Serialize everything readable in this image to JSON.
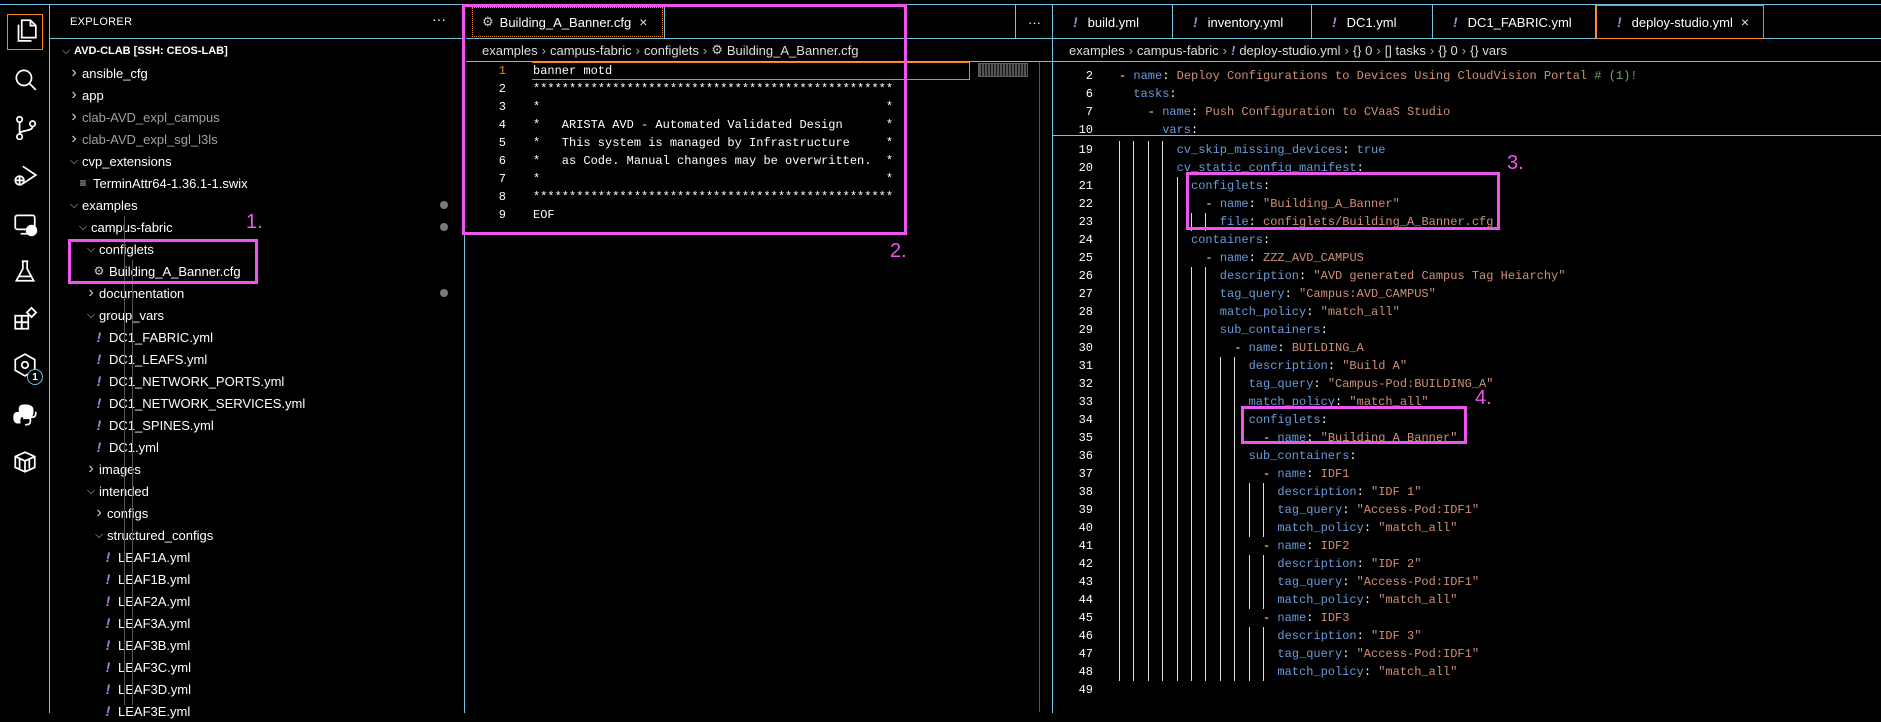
{
  "activity_bar": {
    "items": [
      {
        "name": "explorer-icon",
        "active": true
      },
      {
        "name": "search-icon"
      },
      {
        "name": "source-control-icon"
      },
      {
        "name": "run-debug-icon"
      },
      {
        "name": "remote-explorer-icon"
      },
      {
        "name": "testing-flask-icon"
      },
      {
        "name": "extensions-icon"
      },
      {
        "name": "containerlab-icon",
        "badge": "1"
      },
      {
        "name": "python-icon"
      },
      {
        "name": "docker-container-icon"
      }
    ]
  },
  "sidebar": {
    "title": "EXPLORER",
    "more": "···",
    "tree": [
      {
        "label": "AVD-CLAB [SSH: CEOS-LAB]",
        "level": 0,
        "type": "folder",
        "open": true,
        "root": true
      },
      {
        "label": "ansible_cfg",
        "level": 1,
        "type": "folder",
        "open": false
      },
      {
        "label": "app",
        "level": 1,
        "type": "folder",
        "open": false
      },
      {
        "label": "clab-AVD_expl_campus",
        "level": 1,
        "type": "folder",
        "open": false,
        "dim": true
      },
      {
        "label": "clab-AVD_expl_sgl_l3ls",
        "level": 1,
        "type": "folder",
        "open": false,
        "dim": true
      },
      {
        "label": "cvp_extensions",
        "level": 1,
        "type": "folder",
        "open": true
      },
      {
        "label": "TerminAttr64-1.36.1-1.swix",
        "level": 2,
        "type": "file",
        "icon": "lines"
      },
      {
        "label": "examples",
        "level": 1,
        "type": "folder",
        "open": true,
        "dot": true
      },
      {
        "label": "campus-fabric",
        "level": 2,
        "type": "folder",
        "open": true,
        "dot": true
      },
      {
        "label": "configlets",
        "level": 3,
        "type": "folder",
        "open": true
      },
      {
        "label": "Building_A_Banner.cfg",
        "level": 4,
        "type": "file",
        "icon": "gear"
      },
      {
        "label": "documentation",
        "level": 3,
        "type": "folder",
        "open": false,
        "dot": true
      },
      {
        "label": "group_vars",
        "level": 3,
        "type": "folder",
        "open": true
      },
      {
        "label": "DC1_FABRIC.yml",
        "level": 4,
        "type": "file",
        "icon": "yml"
      },
      {
        "label": "DC1_LEAFS.yml",
        "level": 4,
        "type": "file",
        "icon": "yml"
      },
      {
        "label": "DC1_NETWORK_PORTS.yml",
        "level": 4,
        "type": "file",
        "icon": "yml"
      },
      {
        "label": "DC1_NETWORK_SERVICES.yml",
        "level": 4,
        "type": "file",
        "icon": "yml"
      },
      {
        "label": "DC1_SPINES.yml",
        "level": 4,
        "type": "file",
        "icon": "yml"
      },
      {
        "label": "DC1.yml",
        "level": 4,
        "type": "file",
        "icon": "yml"
      },
      {
        "label": "images",
        "level": 3,
        "type": "folder",
        "open": false
      },
      {
        "label": "intended",
        "level": 3,
        "type": "folder",
        "open": true
      },
      {
        "label": "configs",
        "level": 4,
        "type": "folder",
        "open": false
      },
      {
        "label": "structured_configs",
        "level": 4,
        "type": "folder",
        "open": true
      },
      {
        "label": "LEAF1A.yml",
        "level": 5,
        "type": "file",
        "icon": "yml"
      },
      {
        "label": "LEAF1B.yml",
        "level": 5,
        "type": "file",
        "icon": "yml"
      },
      {
        "label": "LEAF2A.yml",
        "level": 5,
        "type": "file",
        "icon": "yml"
      },
      {
        "label": "LEAF3A.yml",
        "level": 5,
        "type": "file",
        "icon": "yml"
      },
      {
        "label": "LEAF3B.yml",
        "level": 5,
        "type": "file",
        "icon": "yml"
      },
      {
        "label": "LEAF3C.yml",
        "level": 5,
        "type": "file",
        "icon": "yml"
      },
      {
        "label": "LEAF3D.yml",
        "level": 5,
        "type": "file",
        "icon": "yml"
      },
      {
        "label": "LEAF3E.yml",
        "level": 5,
        "type": "file",
        "icon": "yml"
      }
    ]
  },
  "editor_left": {
    "tab": {
      "label": "Building_A_Banner.cfg",
      "close": "×"
    },
    "more": "···",
    "breadcrumb": [
      "examples",
      "campus-fabric",
      "configlets",
      "Building_A_Banner.cfg"
    ],
    "lines": [
      {
        "n": "1",
        "text": "banner motd"
      },
      {
        "n": "2",
        "text": "**************************************************"
      },
      {
        "n": "3",
        "text": "*                                                *"
      },
      {
        "n": "4",
        "text": "*   ARISTA AVD - Automated Validated Design      *"
      },
      {
        "n": "5",
        "text": "*   This system is managed by Infrastructure     *"
      },
      {
        "n": "6",
        "text": "*   as Code. Manual changes may be overwritten.  *"
      },
      {
        "n": "7",
        "text": "*                                                *"
      },
      {
        "n": "8",
        "text": "**************************************************"
      },
      {
        "n": "9",
        "text": "EOF"
      }
    ]
  },
  "editor_right": {
    "tabs": [
      {
        "label": "build.yml"
      },
      {
        "label": "inventory.yml"
      },
      {
        "label": "DC1.yml"
      },
      {
        "label": "DC1_FABRIC.yml"
      },
      {
        "label": "deploy-studio.yml",
        "active": true,
        "close": "×"
      }
    ],
    "breadcrumb": [
      "examples",
      "campus-fabric",
      "deploy-studio.yml",
      "{} 0",
      "[] tasks",
      "{} 0",
      "{} vars"
    ],
    "sticky": [
      {
        "n": "2",
        "indent": 0,
        "t": [
          [
            "p",
            "- "
          ],
          [
            "k",
            "name"
          ],
          [
            "p",
            ": "
          ],
          [
            "v",
            "Deploy Configurations to Devices Using CloudVision Portal "
          ],
          [
            "c",
            "# (1)!"
          ]
        ]
      },
      {
        "n": "6",
        "indent": 2,
        "t": [
          [
            "k",
            "tasks"
          ],
          [
            "p",
            ":"
          ]
        ]
      },
      {
        "n": "7",
        "indent": 4,
        "t": [
          [
            "p",
            "- "
          ],
          [
            "k",
            "name"
          ],
          [
            "p",
            ": "
          ],
          [
            "v",
            "Push Configuration to CVaaS Studio"
          ]
        ]
      },
      {
        "n": "10",
        "indent": 6,
        "t": [
          [
            "k",
            "vars"
          ],
          [
            "p",
            ":"
          ]
        ]
      }
    ],
    "lines": [
      {
        "n": "19",
        "indent": 8,
        "t": [
          [
            "k",
            "cv_skip_missing_devices"
          ],
          [
            "p",
            ": "
          ],
          [
            "b",
            "true"
          ]
        ]
      },
      {
        "n": "20",
        "indent": 8,
        "t": [
          [
            "k",
            "cv_static_config_manifest"
          ],
          [
            "p",
            ":"
          ]
        ]
      },
      {
        "n": "21",
        "indent": 10,
        "t": [
          [
            "k",
            "configlets"
          ],
          [
            "p",
            ":"
          ]
        ]
      },
      {
        "n": "22",
        "indent": 10,
        "t": [
          [
            "p",
            "  - "
          ],
          [
            "k",
            "name"
          ],
          [
            "p",
            ": "
          ],
          [
            "v",
            "\"Building_A_Banner\""
          ]
        ]
      },
      {
        "n": "23",
        "indent": 14,
        "t": [
          [
            "k",
            "file"
          ],
          [
            "p",
            ": "
          ],
          [
            "v",
            "configlets/Building_A_Banner.cfg"
          ]
        ]
      },
      {
        "n": "24",
        "indent": 10,
        "t": [
          [
            "k",
            "containers"
          ],
          [
            "p",
            ":"
          ]
        ]
      },
      {
        "n": "25",
        "indent": 10,
        "t": [
          [
            "p",
            "  - "
          ],
          [
            "k",
            "name"
          ],
          [
            "p",
            ": "
          ],
          [
            "v",
            "ZZZ_AVD_CAMPUS"
          ]
        ]
      },
      {
        "n": "26",
        "indent": 14,
        "t": [
          [
            "k",
            "description"
          ],
          [
            "p",
            ": "
          ],
          [
            "v",
            "\"AVD generated Campus Tag Heiarchy\""
          ]
        ]
      },
      {
        "n": "27",
        "indent": 14,
        "t": [
          [
            "k",
            "tag_query"
          ],
          [
            "p",
            ": "
          ],
          [
            "v",
            "\"Campus:AVD_CAMPUS\""
          ]
        ]
      },
      {
        "n": "28",
        "indent": 14,
        "t": [
          [
            "k",
            "match_policy"
          ],
          [
            "p",
            ": "
          ],
          [
            "v",
            "\"match_all\""
          ]
        ]
      },
      {
        "n": "29",
        "indent": 14,
        "t": [
          [
            "k",
            "sub_containers"
          ],
          [
            "p",
            ":"
          ]
        ]
      },
      {
        "n": "30",
        "indent": 14,
        "t": [
          [
            "p",
            "  - "
          ],
          [
            "k",
            "name"
          ],
          [
            "p",
            ": "
          ],
          [
            "v",
            "BUILDING_A"
          ]
        ]
      },
      {
        "n": "31",
        "indent": 18,
        "t": [
          [
            "k",
            "description"
          ],
          [
            "p",
            ": "
          ],
          [
            "v",
            "\"Build A\""
          ]
        ]
      },
      {
        "n": "32",
        "indent": 18,
        "t": [
          [
            "k",
            "tag_query"
          ],
          [
            "p",
            ": "
          ],
          [
            "v",
            "\"Campus-Pod:BUILDING_A\""
          ]
        ]
      },
      {
        "n": "33",
        "indent": 18,
        "t": [
          [
            "k",
            "match_policy"
          ],
          [
            "p",
            ": "
          ],
          [
            "v",
            "\"match_all\""
          ]
        ]
      },
      {
        "n": "34",
        "indent": 18,
        "t": [
          [
            "k",
            "configlets"
          ],
          [
            "p",
            ":"
          ]
        ]
      },
      {
        "n": "35",
        "indent": 18,
        "t": [
          [
            "p",
            "  - "
          ],
          [
            "k",
            "name"
          ],
          [
            "p",
            ": "
          ],
          [
            "v",
            "\"Building_A_Banner\""
          ]
        ]
      },
      {
        "n": "36",
        "indent": 18,
        "t": [
          [
            "k",
            "sub_containers"
          ],
          [
            "p",
            ":"
          ]
        ]
      },
      {
        "n": "37",
        "indent": 18,
        "t": [
          [
            "p",
            "  - "
          ],
          [
            "k",
            "name"
          ],
          [
            "p",
            ": "
          ],
          [
            "v",
            "IDF1"
          ]
        ]
      },
      {
        "n": "38",
        "indent": 22,
        "t": [
          [
            "k",
            "description"
          ],
          [
            "p",
            ": "
          ],
          [
            "v",
            "\"IDF 1\""
          ]
        ]
      },
      {
        "n": "39",
        "indent": 22,
        "t": [
          [
            "k",
            "tag_query"
          ],
          [
            "p",
            ": "
          ],
          [
            "v",
            "\"Access-Pod:IDF1\""
          ]
        ]
      },
      {
        "n": "40",
        "indent": 22,
        "t": [
          [
            "k",
            "match_policy"
          ],
          [
            "p",
            ": "
          ],
          [
            "v",
            "\"match_all\""
          ]
        ]
      },
      {
        "n": "41",
        "indent": 18,
        "t": [
          [
            "p",
            "  - "
          ],
          [
            "k",
            "name"
          ],
          [
            "p",
            ": "
          ],
          [
            "v",
            "IDF2"
          ]
        ]
      },
      {
        "n": "42",
        "indent": 22,
        "t": [
          [
            "k",
            "description"
          ],
          [
            "p",
            ": "
          ],
          [
            "v",
            "\"IDF 2\""
          ]
        ]
      },
      {
        "n": "43",
        "indent": 22,
        "t": [
          [
            "k",
            "tag_query"
          ],
          [
            "p",
            ": "
          ],
          [
            "v",
            "\"Access-Pod:IDF1\""
          ]
        ]
      },
      {
        "n": "44",
        "indent": 22,
        "t": [
          [
            "k",
            "match_policy"
          ],
          [
            "p",
            ": "
          ],
          [
            "v",
            "\"match_all\""
          ]
        ]
      },
      {
        "n": "45",
        "indent": 18,
        "t": [
          [
            "p",
            "  - "
          ],
          [
            "k",
            "name"
          ],
          [
            "p",
            ": "
          ],
          [
            "v",
            "IDF3"
          ]
        ]
      },
      {
        "n": "46",
        "indent": 22,
        "t": [
          [
            "k",
            "description"
          ],
          [
            "p",
            ": "
          ],
          [
            "v",
            "\"IDF 3\""
          ]
        ]
      },
      {
        "n": "47",
        "indent": 22,
        "t": [
          [
            "k",
            "tag_query"
          ],
          [
            "p",
            ": "
          ],
          [
            "v",
            "\"Access-Pod:IDF1\""
          ]
        ]
      },
      {
        "n": "48",
        "indent": 22,
        "t": [
          [
            "k",
            "match_policy"
          ],
          [
            "p",
            ": "
          ],
          [
            "v",
            "\"match_all\""
          ]
        ]
      },
      {
        "n": "49",
        "indent": 0,
        "t": []
      }
    ]
  },
  "annotations": [
    "1.",
    "2.",
    "3.",
    "4."
  ],
  "colors": {
    "highlight": "#ee55ee",
    "border": "#6fc3df",
    "active": "#f38518",
    "yaml_icon": "#b180d7"
  }
}
